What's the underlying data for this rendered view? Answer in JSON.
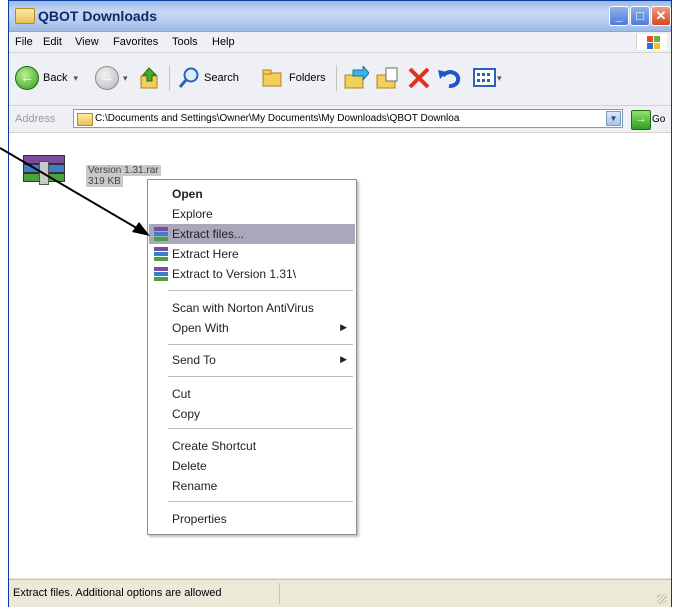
{
  "window": {
    "title": "QBOT Downloads",
    "controls": {
      "minimize": "_",
      "maximize": "□",
      "close": "✕"
    }
  },
  "menubar": {
    "items": [
      "File",
      "Edit",
      "View",
      "Favorites",
      "Tools",
      "Help"
    ]
  },
  "toolbar": {
    "back_label": "Back",
    "search_label": "Search",
    "folders_label": "Folders",
    "dropdown_glyph": "▾"
  },
  "address": {
    "label": "Address",
    "value": "C:\\Documents and Settings\\Owner\\My Documents\\My Downloads\\QBOT Downloa",
    "go_label": "Go"
  },
  "file": {
    "name": "Version 1.31.rar",
    "size": "319 KB"
  },
  "context_menu": {
    "items": [
      {
        "label": "Open",
        "bold": true
      },
      {
        "label": "Explore"
      },
      {
        "label": "Extract files...",
        "icon": "winrar-icon",
        "highlighted": true
      },
      {
        "label": "Extract Here",
        "icon": "winrar-icon"
      },
      {
        "label": "Extract to Version 1.31\\",
        "icon": "winrar-icon"
      },
      {
        "label": "Scan with Norton AntiVirus"
      },
      {
        "label": "Open With",
        "submenu": true
      },
      {
        "label": "Send To",
        "submenu": true
      },
      {
        "label": "Cut"
      },
      {
        "label": "Copy"
      },
      {
        "label": "Create Shortcut"
      },
      {
        "label": "Delete"
      },
      {
        "label": "Rename"
      },
      {
        "label": "Properties"
      }
    ],
    "submenu_glyph": "▶"
  },
  "statusbar": {
    "text": "Extract files. Additional options are allowed"
  },
  "colors": {
    "titlebar": "#b8cdf0",
    "highlight": "#a8a8ba",
    "close_button": "#d6471f",
    "go_button": "#2e9e22"
  }
}
